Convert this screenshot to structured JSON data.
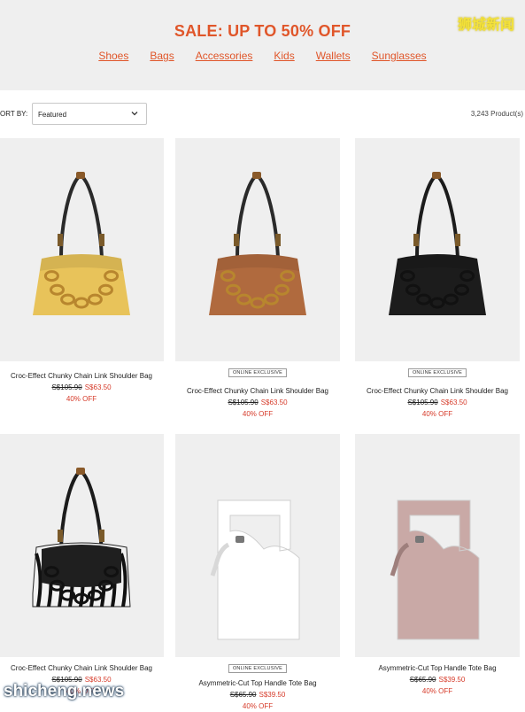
{
  "banner": {
    "title": "SALE: UP TO 50% OFF",
    "nav": [
      "Shoes",
      "Bags",
      "Accessories",
      "Kids",
      "Wallets",
      "Sunglasses"
    ],
    "watermark": "狮城新闻"
  },
  "toolbar": {
    "sort_label": "ORT BY:",
    "sort_value": "Featured",
    "count": "3,243 Product(s)"
  },
  "products": [
    {
      "name": "Croc-Effect Chunky Chain Link Shoulder Bag",
      "old_price": "S$105.90",
      "new_price": "S$63.50",
      "discount": "40% OFF",
      "badge": "",
      "color": "#e8c35a",
      "style": "chain",
      "strap": "#2a2a2a",
      "chain": "#b8862e"
    },
    {
      "name": "Croc-Effect Chunky Chain Link Shoulder Bag",
      "old_price": "S$105.90",
      "new_price": "S$63.50",
      "discount": "40% OFF",
      "badge": "ONLINE EXCLUSIVE",
      "color": "#b06a3e",
      "style": "chain",
      "strap": "#2a2a2a",
      "chain": "#b8862e"
    },
    {
      "name": "Croc-Effect Chunky Chain Link Shoulder Bag",
      "old_price": "S$105.90",
      "new_price": "S$63.50",
      "discount": "40% OFF",
      "badge": "ONLINE EXCLUSIVE",
      "color": "#1c1c1c",
      "style": "chain",
      "strap": "#1c1c1c",
      "chain": "#111111"
    },
    {
      "name": "Croc-Effect Chunky Chain Link Shoulder Bag",
      "old_price": "S$105.90",
      "new_price": "S$63.50",
      "discount": "40% OFF",
      "badge": "",
      "color": "#1f1f1f",
      "style": "zebra",
      "strap": "#1c1c1c",
      "chain": "#111111"
    },
    {
      "name": "Asymmetric-Cut Top Handle Tote Bag",
      "old_price": "S$65.90",
      "new_price": "S$39.50",
      "discount": "40% OFF",
      "badge": "ONLINE EXCLUSIVE",
      "color": "#ffffff",
      "style": "tote",
      "strap": "#ffffff",
      "chain": ""
    },
    {
      "name": "Asymmetric-Cut Top Handle Tote Bag",
      "old_price": "S$65.90",
      "new_price": "S$39.50",
      "discount": "40% OFF",
      "badge": "",
      "color": "#c9a9a6",
      "style": "tote",
      "strap": "#c9a9a6",
      "chain": ""
    }
  ],
  "footer_watermark": "shicheng.news"
}
